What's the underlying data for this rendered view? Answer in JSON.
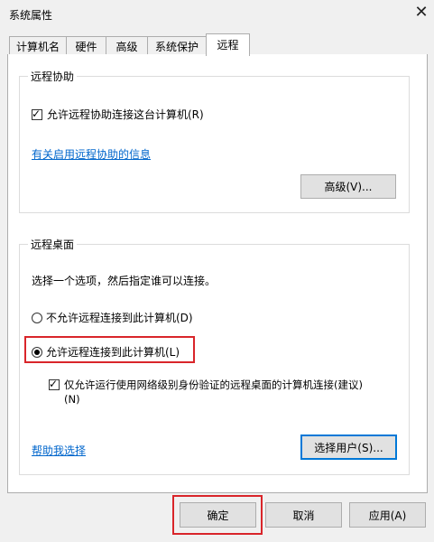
{
  "window": {
    "title": "系统属性"
  },
  "tabs": [
    {
      "label": "计算机名"
    },
    {
      "label": "硬件"
    },
    {
      "label": "高级"
    },
    {
      "label": "系统保护"
    },
    {
      "label": "远程"
    }
  ],
  "remote_assistance": {
    "legend": "远程协助",
    "checkbox_label": "允许远程协助连接这台计算机(R)",
    "checked": true,
    "info_link": "有关启用远程协助的信息",
    "advanced_button": "高级(V)..."
  },
  "remote_desktop": {
    "legend": "远程桌面",
    "instruction": "选择一个选项，然后指定谁可以连接。",
    "option_disallow": "不允许远程连接到此计算机(D)",
    "option_allow": "允许远程连接到此计算机(L)",
    "nla_label_line1": "仅允许运行使用网络级别身份验证的远程桌面的计算机连接(建议)",
    "nla_label_line2": "(N)",
    "nla_checked": true,
    "help_link": "帮助我选择",
    "select_users_button": "选择用户(S)..."
  },
  "footer": {
    "ok": "确定",
    "cancel": "取消",
    "apply": "应用(A)"
  }
}
